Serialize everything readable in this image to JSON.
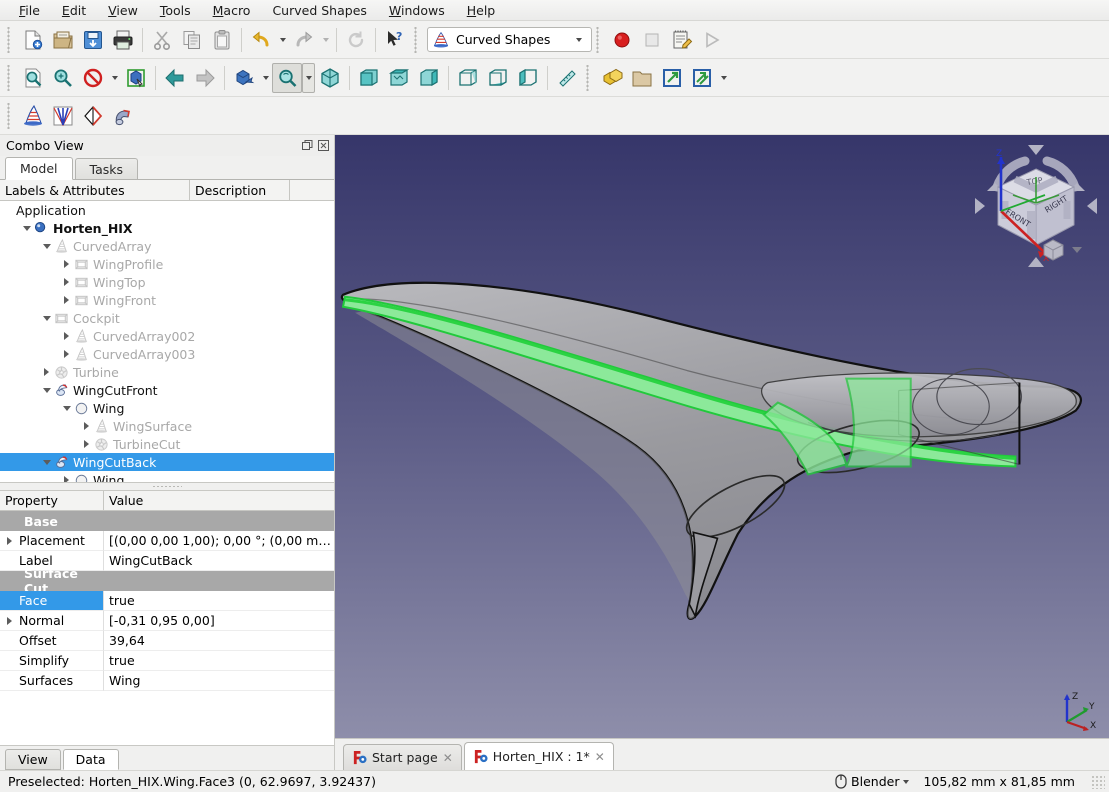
{
  "menu": {
    "items": [
      {
        "label": "File",
        "accel": "F"
      },
      {
        "label": "Edit",
        "accel": "E"
      },
      {
        "label": "View",
        "accel": "V"
      },
      {
        "label": "Tools",
        "accel": "T"
      },
      {
        "label": "Macro",
        "accel": "M"
      },
      {
        "label": "Curved Shapes",
        "accel": ""
      },
      {
        "label": "Windows",
        "accel": "W"
      },
      {
        "label": "Help",
        "accel": "H"
      }
    ]
  },
  "toolbar_file": {
    "buttons": [
      {
        "name": "new-document-button",
        "icon": "new-file-icon"
      },
      {
        "name": "open-document-button",
        "icon": "open-folder-icon"
      },
      {
        "name": "save-document-button",
        "icon": "save-icon"
      },
      {
        "name": "print-button",
        "icon": "printer-icon"
      },
      {
        "name": "cut-button",
        "icon": "scissors-icon"
      },
      {
        "name": "copy-button",
        "icon": "copy-icon"
      },
      {
        "name": "paste-button",
        "icon": "clipboard-icon"
      },
      {
        "name": "undo-button",
        "icon": "undo-arrow-icon"
      },
      {
        "name": "redo-button",
        "icon": "redo-arrow-icon"
      },
      {
        "name": "refresh-button",
        "icon": "refresh-icon"
      },
      {
        "name": "whats-this-button",
        "icon": "cursor-question-icon"
      }
    ]
  },
  "workbench": {
    "selected": "Curved Shapes",
    "icon": "curved-shapes-icon"
  },
  "toolbar_macro": {
    "buttons": [
      {
        "name": "macro-record-button",
        "icon": "record-circle-icon"
      },
      {
        "name": "macro-stop-button",
        "icon": "stop-square-icon"
      },
      {
        "name": "macros-dialog-button",
        "icon": "macro-edit-icon"
      },
      {
        "name": "execute-macro-button",
        "icon": "play-triangle-icon"
      }
    ]
  },
  "toolbar_view": {
    "buttons": [
      {
        "name": "fit-all-button",
        "icon": "fit-all-icon"
      },
      {
        "name": "fit-selection-button",
        "icon": "fit-selection-icon"
      },
      {
        "name": "draw-style-button",
        "icon": "draw-style-icon"
      },
      {
        "name": "selection-view-button",
        "icon": "box-select-icon"
      },
      {
        "name": "view-back-button",
        "icon": "arrow-left-icon"
      },
      {
        "name": "view-forward-button",
        "icon": "arrow-right-icon"
      },
      {
        "name": "axonometric-button",
        "icon": "axonometric-cube-icon"
      },
      {
        "name": "zoom-button",
        "icon": "zoom-magnifier-icon"
      },
      {
        "name": "isometric-view-button",
        "icon": "isometric-cube-icon"
      },
      {
        "name": "front-view-button",
        "icon": "cube-front-icon"
      },
      {
        "name": "top-view-button",
        "icon": "cube-top-icon"
      },
      {
        "name": "right-view-button",
        "icon": "cube-right-icon"
      },
      {
        "name": "rear-view-button",
        "icon": "cube-rear-icon"
      },
      {
        "name": "bottom-view-button",
        "icon": "cube-bottom-icon"
      },
      {
        "name": "left-view-button",
        "icon": "cube-left-icon"
      },
      {
        "name": "measure-button",
        "icon": "ruler-icon"
      },
      {
        "name": "create-part-button",
        "icon": "part-blocks-icon"
      },
      {
        "name": "create-group-button",
        "icon": "folder-icon"
      },
      {
        "name": "make-link-button",
        "icon": "link-arrow-icon"
      },
      {
        "name": "link-actions-button",
        "icon": "link-arrows-icon"
      }
    ]
  },
  "toolbar_curved_shapes": {
    "buttons": [
      {
        "name": "curved-array-button",
        "icon": "curved-array-icon"
      },
      {
        "name": "interpolation-surface-button",
        "icon": "interpolation-surface-icon"
      },
      {
        "name": "surface-cut-button",
        "icon": "surface-cut-icon"
      },
      {
        "name": "curved-segment-button",
        "icon": "curved-segment-icon"
      }
    ]
  },
  "combo_view": {
    "title": "Combo View",
    "float_button": "float-icon",
    "close_button": "close-icon",
    "tabs": [
      {
        "label": "Model",
        "active": true
      },
      {
        "label": "Tasks",
        "active": false
      }
    ],
    "tree_headers": [
      "Labels & Attributes",
      "Description",
      ""
    ],
    "tree": [
      {
        "label": "Application",
        "depth": 0,
        "twist": "none",
        "icon": "none",
        "dim": false,
        "bold": false,
        "selected": false
      },
      {
        "label": "Horten_HIX",
        "depth": 1,
        "twist": "down",
        "icon": "document-icon",
        "dim": false,
        "bold": true,
        "selected": false
      },
      {
        "label": "CurvedArray",
        "depth": 2,
        "twist": "down",
        "icon": "curved-array-icon",
        "dim": true,
        "bold": false,
        "selected": false
      },
      {
        "label": "WingProfile",
        "depth": 3,
        "twist": "right",
        "icon": "shape-box-icon",
        "dim": true,
        "bold": false,
        "selected": false
      },
      {
        "label": "WingTop",
        "depth": 3,
        "twist": "right",
        "icon": "shape-box-icon",
        "dim": true,
        "bold": false,
        "selected": false
      },
      {
        "label": "WingFront",
        "depth": 3,
        "twist": "right",
        "icon": "shape-box-icon",
        "dim": true,
        "bold": false,
        "selected": false
      },
      {
        "label": "Cockpit",
        "depth": 2,
        "twist": "down",
        "icon": "shape-box-icon",
        "dim": true,
        "bold": false,
        "selected": false
      },
      {
        "label": "CurvedArray002",
        "depth": 3,
        "twist": "right",
        "icon": "curved-array-icon",
        "dim": true,
        "bold": false,
        "selected": false
      },
      {
        "label": "CurvedArray003",
        "depth": 3,
        "twist": "right",
        "icon": "curved-array-icon",
        "dim": true,
        "bold": false,
        "selected": false
      },
      {
        "label": "Turbine",
        "depth": 2,
        "twist": "right",
        "icon": "turbine-icon",
        "dim": true,
        "bold": false,
        "selected": false
      },
      {
        "label": "WingCutFront",
        "depth": 2,
        "twist": "down",
        "icon": "surface-cut-icon",
        "dim": false,
        "bold": false,
        "selected": false
      },
      {
        "label": "Wing",
        "depth": 3,
        "twist": "down",
        "icon": "surface-icon",
        "dim": false,
        "bold": false,
        "selected": false
      },
      {
        "label": "WingSurface",
        "depth": 4,
        "twist": "right",
        "icon": "curved-array-icon",
        "dim": true,
        "bold": false,
        "selected": false
      },
      {
        "label": "TurbineCut",
        "depth": 4,
        "twist": "right",
        "icon": "turbine-icon",
        "dim": true,
        "bold": false,
        "selected": false
      },
      {
        "label": "WingCutBack",
        "depth": 2,
        "twist": "down",
        "icon": "surface-cut-icon",
        "dim": false,
        "bold": false,
        "selected": true
      },
      {
        "label": "Wing",
        "depth": 3,
        "twist": "right",
        "icon": "surface-icon",
        "dim": false,
        "bold": false,
        "selected": false
      }
    ],
    "property_headers": [
      "Property",
      "Value"
    ],
    "properties": [
      {
        "kind": "group",
        "name": "Base",
        "value": "",
        "expandable": false,
        "highlight": false
      },
      {
        "kind": "row",
        "name": "Placement",
        "value": "[(0,00 0,00 1,00); 0,00 °; (0,00 m…",
        "expandable": true,
        "highlight": false
      },
      {
        "kind": "row",
        "name": "Label",
        "value": "WingCutBack",
        "expandable": false,
        "highlight": false
      },
      {
        "kind": "group",
        "name": "Surface Cut",
        "value": "",
        "expandable": false,
        "highlight": false
      },
      {
        "kind": "row",
        "name": "Face",
        "value": "true",
        "expandable": false,
        "highlight": true
      },
      {
        "kind": "row",
        "name": "Normal",
        "value": "[-0,31 0,95 0,00]",
        "expandable": true,
        "highlight": false
      },
      {
        "kind": "row",
        "name": "Offset",
        "value": "39,64",
        "expandable": false,
        "highlight": false
      },
      {
        "kind": "row",
        "name": "Simplify",
        "value": "true",
        "expandable": false,
        "highlight": false
      },
      {
        "kind": "row",
        "name": "Surfaces",
        "value": "Wing",
        "expandable": false,
        "highlight": false
      }
    ],
    "bottom_tabs": [
      {
        "label": "View",
        "active": false
      },
      {
        "label": "Data",
        "active": true
      }
    ]
  },
  "view3d": {
    "navigation_cube": "navigation-cube",
    "axis_labels": {
      "x": "X",
      "y": "Y",
      "z": "Z"
    },
    "cube_face_labels": {
      "top": "TOP",
      "front": "FRONT",
      "right": "RIGHT"
    }
  },
  "document_tabs": [
    {
      "label": "Start page",
      "active": false,
      "icon": "freecad-icon",
      "close": "close-icon"
    },
    {
      "label": "Horten_HIX : 1*",
      "active": true,
      "icon": "freecad-icon",
      "close": "close-icon"
    }
  ],
  "statusbar": {
    "message": "Preselected: Horten_HIX.Wing.Face3 (0, 62.9697, 3.92437)",
    "navigation_mode": "Blender",
    "navigation_icon": "mouse-icon",
    "dimensions": "105,82 mm x 81,85 mm"
  },
  "colors": {
    "selection_blue": "#3399e8",
    "group_grey": "#a8a8a8",
    "highlight_green": "#35d94b",
    "bg_top": "#36366a",
    "bg_bottom": "#8e8eaa"
  }
}
